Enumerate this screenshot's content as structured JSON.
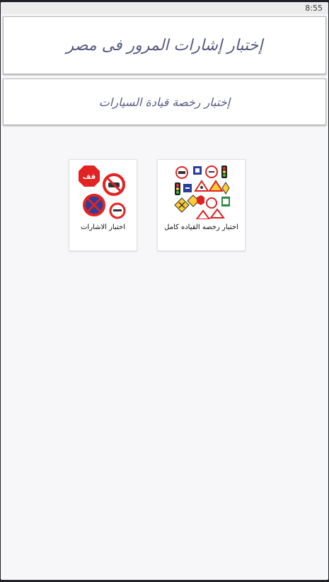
{
  "status_bar": {
    "time": "8:55"
  },
  "header": {
    "title": "إختبار إشارات المرور فى مصر",
    "subtitle": "إختبار رخصة قيادة السيارات"
  },
  "cards": [
    {
      "label": "اختبار رخصه القياده كامل",
      "icon": "traffic-signs-collage-icon"
    },
    {
      "label": "اختبار الاشارات",
      "icon": "stop-and-prohibition-signs-icon",
      "sign_text": "قف"
    }
  ]
}
